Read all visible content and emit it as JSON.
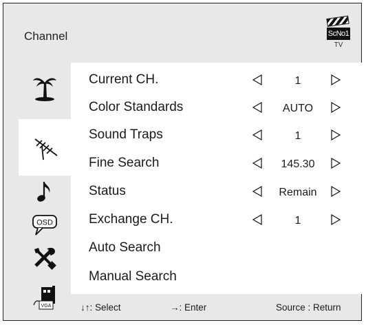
{
  "header": {
    "title": "Channel",
    "brand_logo": "ScNo1",
    "brand_sub": "TV"
  },
  "sidebar": {
    "items": [
      {
        "icon": "palm-tree-icon"
      },
      {
        "icon": "antenna-icon",
        "active": true
      },
      {
        "icon": "music-note-icon"
      },
      {
        "icon": "osd-icon",
        "label": "OSD"
      },
      {
        "icon": "tools-icon"
      },
      {
        "icon": "vga-icon",
        "label": "VGA"
      }
    ]
  },
  "menu": {
    "rows": [
      {
        "label": "Current CH.",
        "value": "1"
      },
      {
        "label": "Color Standards",
        "value": "AUTO"
      },
      {
        "label": "Sound Traps",
        "value": "1"
      },
      {
        "label": "Fine Search",
        "value": "145.30"
      },
      {
        "label": "Status",
        "value": "Remain"
      },
      {
        "label": "Exchange CH.",
        "value": "1"
      },
      {
        "label": "Auto Search"
      },
      {
        "label": "Manual Search"
      }
    ]
  },
  "footer": {
    "select_hint": "↓↑: Select",
    "enter_hint": "→: Enter",
    "return_hint": "Source : Return"
  }
}
